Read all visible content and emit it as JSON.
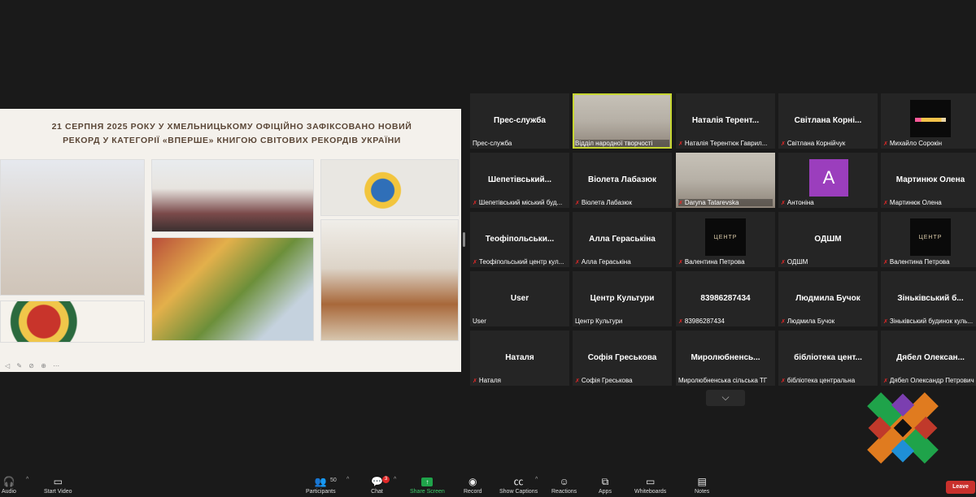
{
  "slide": {
    "title_line1": "21 СЕРПНЯ 2025 РОКУ У ХМЕЛЬНИЦЬКОМУ ОФІЦІЙНО ЗАФІКСОВАНО НОВИЙ",
    "title_line2": "РЕКОРД У КАТЕГОРІЇ «ВПЕРШЕ» КНИГОЮ СВІТОВИХ РЕКОРДІВ УКРАЇНИ",
    "controls": "◁ ✎ ⊘ ⊕ ⋯"
  },
  "tiles": [
    {
      "name": "Прес-служба",
      "label": "Прес-служба",
      "muted": false
    },
    {
      "name": "",
      "label": "Відділ народної творчості",
      "muted": false
    },
    {
      "name": "Наталія Терент...",
      "label": "Наталія Терентюк Гаврил...",
      "muted": true
    },
    {
      "name": "Світлана Корні...",
      "label": "Світлана Корнійчук",
      "muted": true
    },
    {
      "name": "",
      "label": "Михайло Сорокін",
      "muted": true
    },
    {
      "name": "Шепетівський...",
      "label": "Шепетівський міський буд...",
      "muted": true
    },
    {
      "name": "Віолета Лабазюк",
      "label": "Віолета Лабазюк",
      "muted": true
    },
    {
      "name": "",
      "label": "Daryna Tatarevska",
      "muted": true
    },
    {
      "name": "",
      "label": "Антоніна",
      "muted": true,
      "avatar_letter": "A"
    },
    {
      "name": "Мартинюк Олена",
      "label": "Мартинюк Олена",
      "muted": true
    },
    {
      "name": "Теофіпольськи...",
      "label": "Теофіпольський центр кул...",
      "muted": true
    },
    {
      "name": "Алла Гераськіна",
      "label": "Алла Гераськіна",
      "muted": true
    },
    {
      "name": "",
      "label": "Валентина Петрова",
      "muted": true
    },
    {
      "name": "ОДШМ",
      "label": "ОДШМ",
      "muted": true
    },
    {
      "name": "",
      "label": "Валентина Петрова",
      "muted": true
    },
    {
      "name": "User",
      "label": "User",
      "muted": false
    },
    {
      "name": "Центр Культури",
      "label": "Центр Культури",
      "muted": false
    },
    {
      "name": "83986287434",
      "label": "83986287434",
      "muted": true
    },
    {
      "name": "Людмила Бучок",
      "label": "Людмила Бучок",
      "muted": true
    },
    {
      "name": "Зіньківський б...",
      "label": "Зіньківський будинок куль...",
      "muted": true
    },
    {
      "name": "Наталя",
      "label": "Наталя",
      "muted": true
    },
    {
      "name": "Софія Греськова",
      "label": "Софія Греськова",
      "muted": true
    },
    {
      "name": "Миролюбненсь...",
      "label": "Миролюбненська сільська ТГ",
      "muted": false
    },
    {
      "name": "бібліотека цент...",
      "label": "бібліотека центральна",
      "muted": true
    },
    {
      "name": "Дябел Олексан...",
      "label": "Дябел Олександр Петрович",
      "muted": true
    }
  ],
  "avatar_text": "ЦЕНТР",
  "expand_icon": "⌵",
  "toolbar": {
    "audio": "Audio",
    "video": "Start Video",
    "participants": "Participants",
    "participants_count": "50",
    "chat": "Chat",
    "chat_badge": "3",
    "share": "Share Screen",
    "record": "Record",
    "captions": "Show Captions",
    "reactions": "Reactions",
    "apps": "Apps",
    "whiteboards": "Whiteboards",
    "notes": "Notes",
    "leave": "Leave"
  },
  "colors": {
    "active_speaker": "#c6d630",
    "muted": "#e02828",
    "share_green": "#1fa34a",
    "leave_red": "#c9302c"
  }
}
